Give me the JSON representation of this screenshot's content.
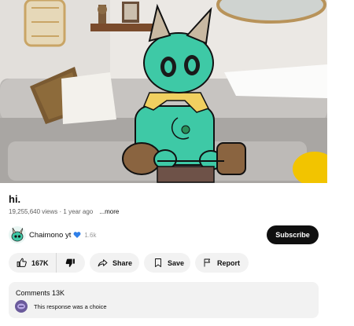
{
  "video": {
    "description_alt": ""
  },
  "title": "hi.",
  "meta": {
    "views": "19,255,640 views",
    "separator": "·",
    "age": "1 year ago",
    "more": "...more"
  },
  "channel": {
    "name": "Chaimono yt",
    "subscribers": "1.6k",
    "verified_icon": "verified-heart-icon",
    "subscribe_label": "Subscribe"
  },
  "actions": {
    "like_count": "167K",
    "share_label": "Share",
    "save_label": "Save",
    "report_label": "Report"
  },
  "comments": {
    "header": "Comments 13K",
    "preview_text": "This response was a choice"
  },
  "colors": {
    "subscribe_bg": "#0f0f0f",
    "pill_bg": "#f2f2f2",
    "verified": "#2f7fe8",
    "character": "#3ec9a6"
  }
}
